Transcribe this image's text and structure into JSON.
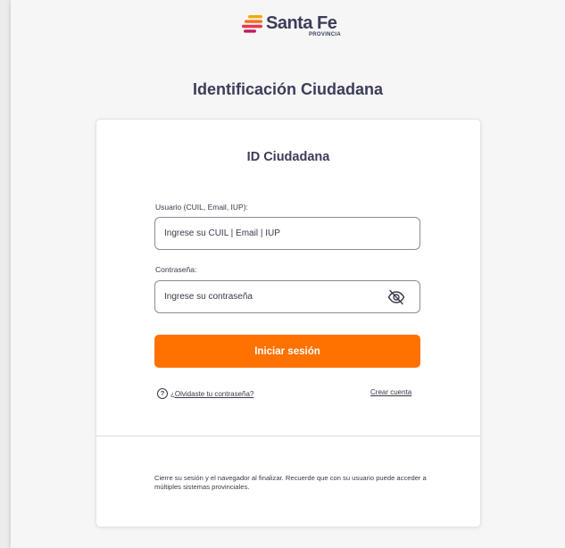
{
  "brand": {
    "name": "Santa Fe",
    "subtitle": "PROVINCIA",
    "colors": [
      "#f6a800",
      "#f36f21",
      "#e8384f",
      "#c2185b"
    ]
  },
  "page_title": "Identificación Ciudadana",
  "card": {
    "title": "ID Ciudadana",
    "user_label": "Usuario (CUIL, Email, IUP):",
    "user_placeholder": "Ingrese su CUIL | Email | IUP",
    "password_label": "Contraseña:",
    "password_placeholder": "Ingrese su contraseña",
    "password_toggle_icon": "eye-slash-icon",
    "login_button": "Iniciar sesión",
    "forgot_link": "¿Olvidaste tu contraseña?",
    "create_link": "Crear cuenta",
    "footer_note": "Cierre su sesión y el navegador al finalizar. Recuerde que con su usuario puede acceder a múltiples sistemas provinciales."
  },
  "accent_color": "#ff7200"
}
